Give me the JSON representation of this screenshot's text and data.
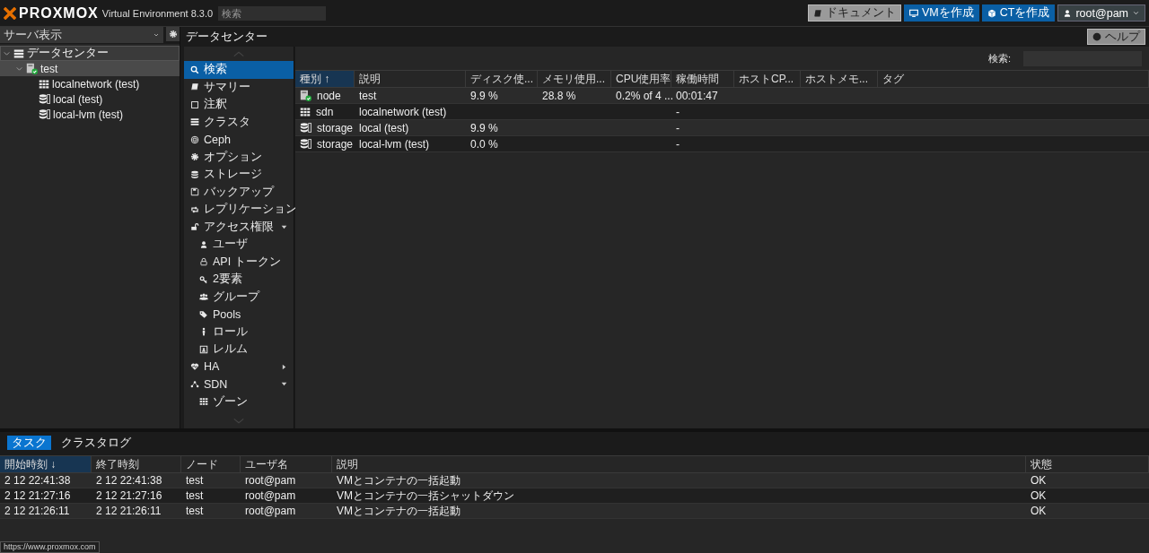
{
  "header": {
    "logo": "PROXMOX",
    "product": "Virtual Environment 8.3.0",
    "search": {
      "placeholder": "検索"
    },
    "buttons": [
      {
        "label": "ドキュメント",
        "kind": "docs"
      },
      {
        "label": "VMを作成",
        "kind": "vm"
      },
      {
        "label": "CTを作成",
        "kind": "ct"
      }
    ],
    "user": "root@pam"
  },
  "sidebar": {
    "view": "サーバ表示",
    "tree": [
      {
        "label": "データセンター",
        "kind": "datacenter",
        "selected": true,
        "hovered": false,
        "expanded": true,
        "children": [
          {
            "label": "test",
            "kind": "node",
            "selected": false,
            "hovered": true,
            "expanded": true,
            "children": [
              {
                "label": "localnetwork (test)",
                "kind": "sdn",
                "selected": false,
                "hovered": false
              },
              {
                "label": "local (test)",
                "kind": "storage",
                "selected": false,
                "hovered": false
              },
              {
                "label": "local-lvm (test)",
                "kind": "storage",
                "selected": false,
                "hovered": false
              }
            ]
          }
        ]
      }
    ]
  },
  "content": {
    "title": "データセンター",
    "help": "ヘルプ",
    "menu": [
      {
        "label": "検索",
        "selected": true
      },
      {
        "label": "サマリー",
        "selected": false
      },
      {
        "label": "注釈",
        "selected": false
      },
      {
        "label": "クラスタ",
        "selected": false
      },
      {
        "label": "Ceph",
        "selected": false
      },
      {
        "label": "オプション",
        "selected": false
      },
      {
        "label": "ストレージ",
        "selected": false
      },
      {
        "label": "バックアップ",
        "selected": false
      },
      {
        "label": "レプリケーション",
        "selected": false
      },
      {
        "label": "アクセス権限",
        "selected": false,
        "expanded": true,
        "children": [
          {
            "label": "ユーザ",
            "selected": false
          },
          {
            "label": "API トークン",
            "selected": false
          },
          {
            "label": "2要素",
            "selected": false
          },
          {
            "label": "グループ",
            "selected": false
          },
          {
            "label": "Pools",
            "selected": false
          },
          {
            "label": "ロール",
            "selected": false
          },
          {
            "label": "レルム",
            "selected": false
          }
        ]
      },
      {
        "label": "HA",
        "selected": false,
        "expanded": false
      },
      {
        "label": "SDN",
        "selected": false,
        "expanded": true,
        "children": [
          {
            "label": "ゾーン",
            "selected": false
          }
        ]
      }
    ],
    "search_label": "検索:",
    "columns": [
      {
        "label": "種別",
        "sorted": true,
        "sort_arrow": "↑"
      },
      {
        "label": "説明",
        "sorted": false
      },
      {
        "label": "ディスク使...",
        "sorted": false
      },
      {
        "label": "メモリ使用...",
        "sorted": false
      },
      {
        "label": "CPU使用率",
        "sorted": false
      },
      {
        "label": "稼働時間",
        "sorted": false
      },
      {
        "label": "ホストCP...",
        "sorted": false
      },
      {
        "label": "ホストメモ...",
        "sorted": false
      },
      {
        "label": "タグ",
        "sorted": false
      }
    ],
    "rows": [
      {
        "kind": "node",
        "type": "node",
        "description": "test",
        "disk": "9.9 %",
        "memory": "28.8 %",
        "cpu": "0.2% of 4 ...",
        "uptime": "00:01:47"
      },
      {
        "kind": "sdn",
        "type": "sdn",
        "description": "localnetwork (test)",
        "uptime": "-"
      },
      {
        "kind": "storage",
        "type": "storage",
        "description": "local (test)",
        "disk": "9.9 %",
        "uptime": "-"
      },
      {
        "kind": "storage",
        "type": "storage",
        "description": "local-lvm (test)",
        "disk": "0.0 %",
        "uptime": "-"
      }
    ]
  },
  "tasks": {
    "tabs": [
      {
        "label": "タスク",
        "selected": true
      },
      {
        "label": "クラスタログ",
        "selected": false
      }
    ],
    "columns": [
      {
        "label": "開始時刻",
        "sorted": true,
        "sort_arrow": "↓"
      },
      {
        "label": "終了時刻",
        "sorted": false
      },
      {
        "label": "ノード",
        "sorted": false
      },
      {
        "label": "ユーザ名",
        "sorted": false
      },
      {
        "label": "説明",
        "sorted": false
      },
      {
        "label": "状態",
        "sorted": false
      }
    ],
    "rows": [
      {
        "start": "2 12 22:41:38",
        "end": "2 12 22:41:38",
        "node": "test",
        "user": "root@pam",
        "description": "VMとコンテナの一括起動",
        "status": "OK"
      },
      {
        "start": "2 12 21:27:16",
        "end": "2 12 21:27:16",
        "node": "test",
        "user": "root@pam",
        "description": "VMとコンテナの一括シャットダウン",
        "status": "OK"
      },
      {
        "start": "2 12 21:26:11",
        "end": "2 12 21:26:11",
        "node": "test",
        "user": "root@pam",
        "description": "VMとコンテナの一括起動",
        "status": "OK"
      }
    ]
  },
  "status_bar": {
    "link": "https://www.proxmox.com"
  }
}
